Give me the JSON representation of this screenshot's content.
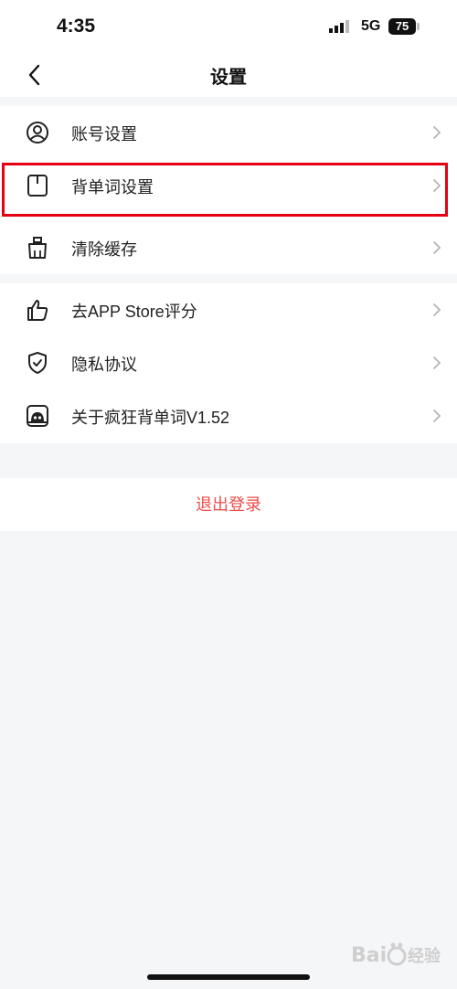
{
  "status_bar": {
    "time": "4:35",
    "network": "5G",
    "battery": "75"
  },
  "nav": {
    "title": "设置"
  },
  "group1": [
    {
      "label": "账号设置",
      "icon": "account-icon"
    },
    {
      "label": "背单词设置",
      "icon": "bookmark-icon"
    },
    {
      "label": "清除缓存",
      "icon": "broom-icon"
    }
  ],
  "group2": [
    {
      "label": "去APP Store评分",
      "icon": "thumbs-up-icon"
    },
    {
      "label": "隐私协议",
      "icon": "shield-icon"
    },
    {
      "label": "关于疯狂背单词V1.52",
      "icon": "app-logo-icon"
    }
  ],
  "logout": {
    "label": "退出登录",
    "color": "#ef4b4b"
  },
  "highlight_color": "#e60012"
}
